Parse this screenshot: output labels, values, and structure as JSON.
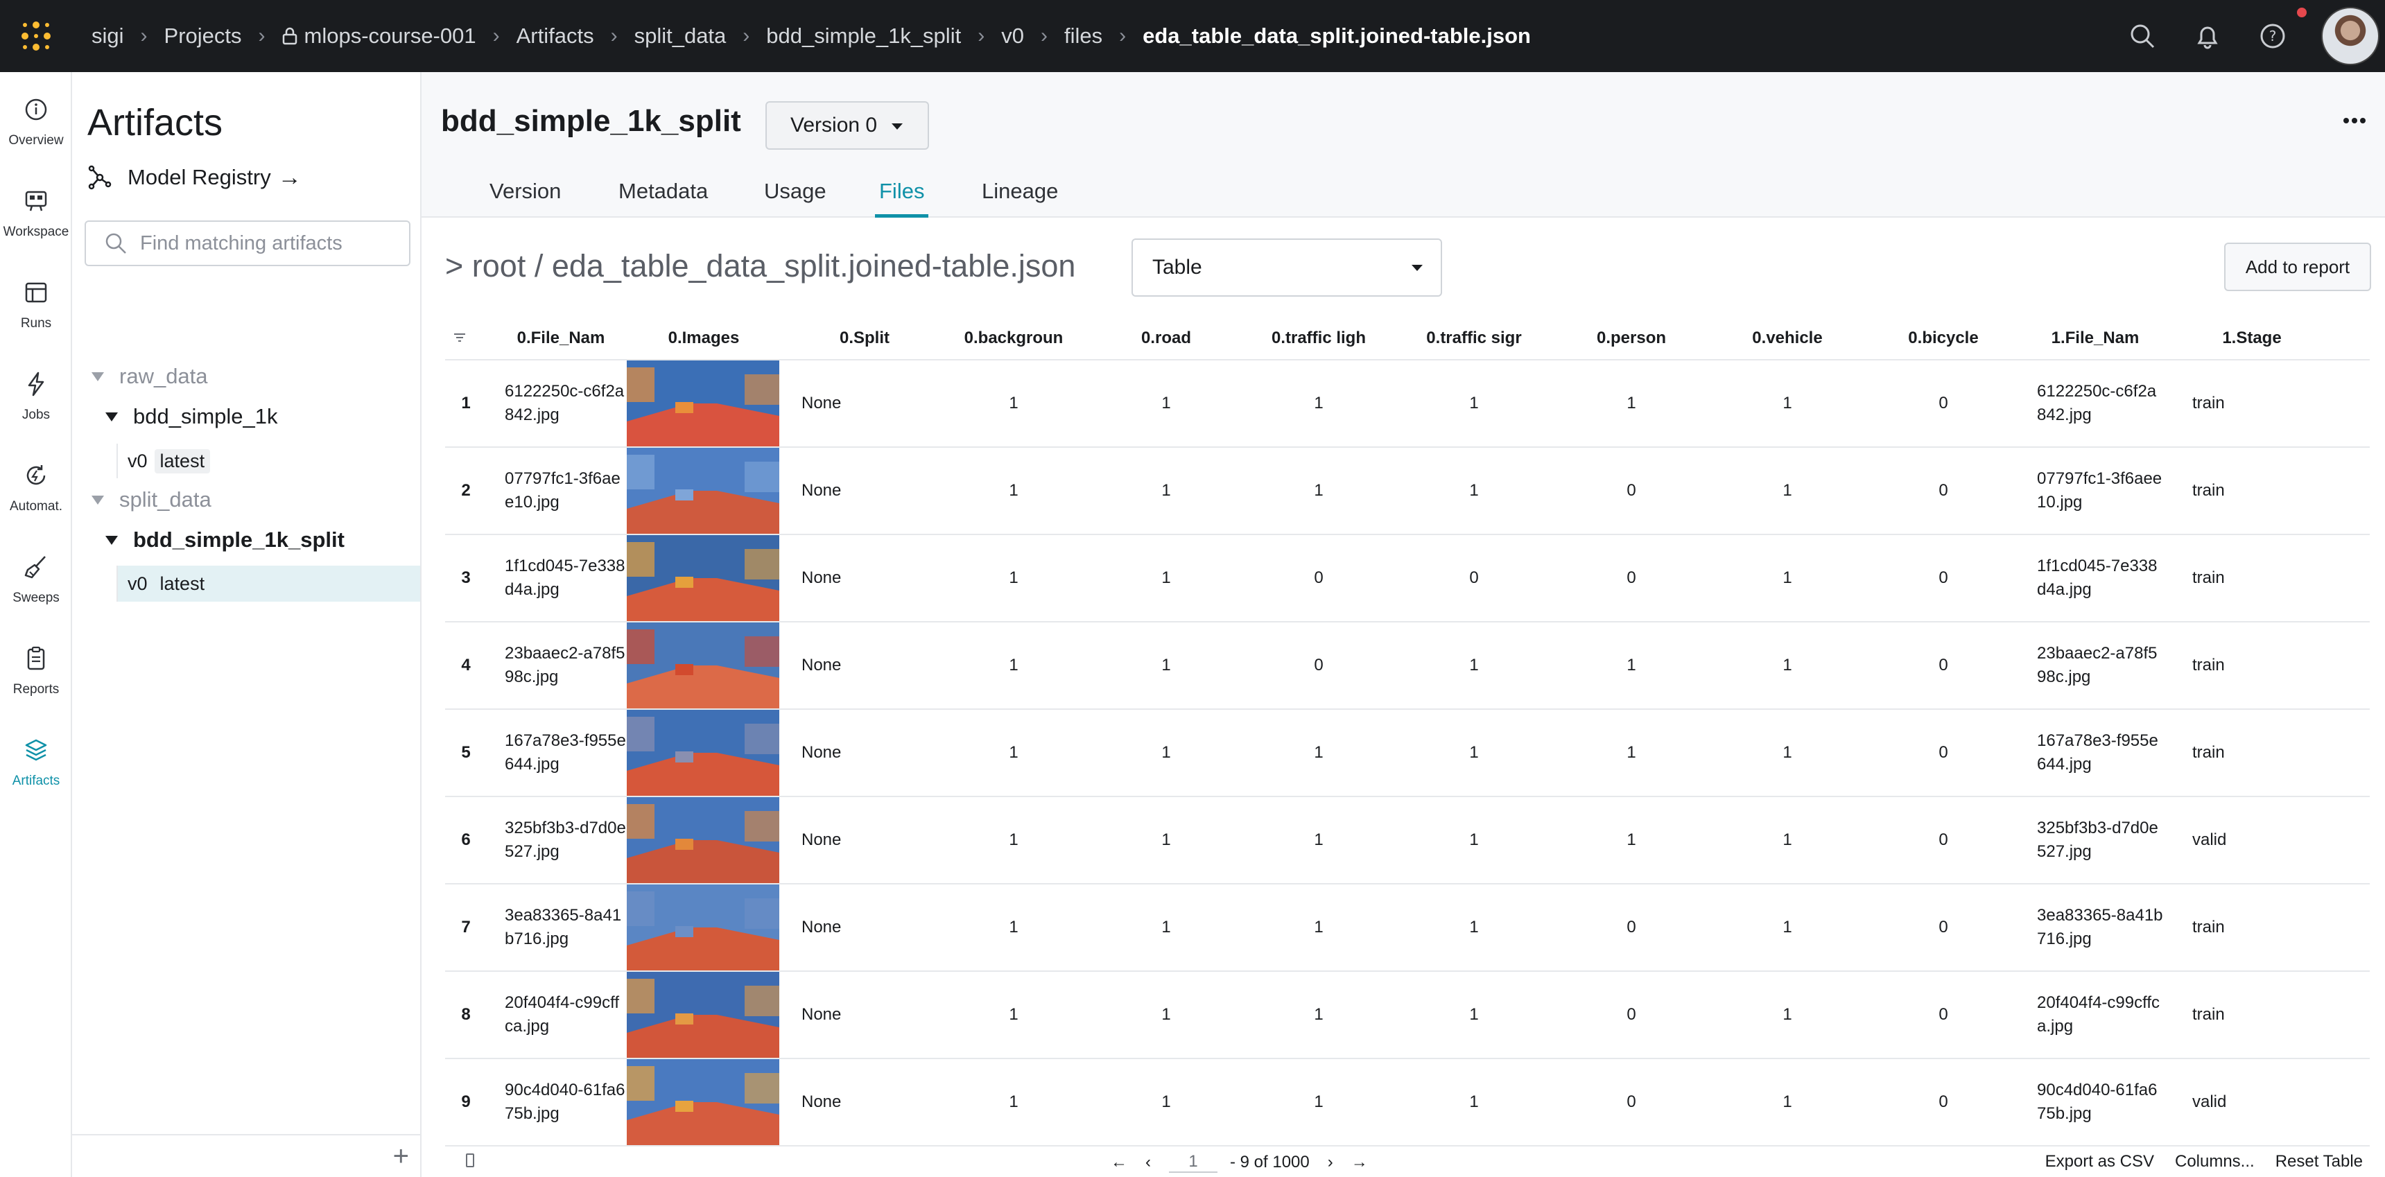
{
  "topbar": {
    "breadcrumbs": [
      "sigi",
      "Projects",
      "mlops-course-001",
      "Artifacts",
      "split_data",
      "bdd_simple_1k_split",
      "v0",
      "files",
      "eda_table_data_split.joined-table.json"
    ]
  },
  "leftnav": {
    "items": [
      {
        "label": "Overview",
        "icon": "info-icon"
      },
      {
        "label": "Workspace",
        "icon": "workspace-icon"
      },
      {
        "label": "Runs",
        "icon": "table-icon"
      },
      {
        "label": "Jobs",
        "icon": "lightning-icon"
      },
      {
        "label": "Automat.",
        "icon": "automation-icon"
      },
      {
        "label": "Sweeps",
        "icon": "broom-icon"
      },
      {
        "label": "Reports",
        "icon": "clipboard-icon"
      },
      {
        "label": "Artifacts",
        "icon": "layers-icon"
      }
    ],
    "active": "Artifacts"
  },
  "sidebar": {
    "title": "Artifacts",
    "model_registry": "Model Registry",
    "search_placeholder": "Find matching artifacts",
    "tree": {
      "type1": "raw_data",
      "type1_artifact": "bdd_simple_1k",
      "type1_version": "v0",
      "type1_tag": "latest",
      "type2": "split_data",
      "type2_artifact": "bdd_simple_1k_split",
      "type2_version": "v0",
      "type2_tag": "latest"
    }
  },
  "header": {
    "artifact_name": "bdd_simple_1k_split",
    "version_select": "Version 0",
    "tabs": [
      "Version",
      "Metadata",
      "Usage",
      "Files",
      "Lineage"
    ],
    "active_tab": "Files"
  },
  "files": {
    "path": "> root / eda_table_data_split.joined-table.json",
    "view_select": "Table",
    "add_to_report": "Add to report"
  },
  "table": {
    "columns": [
      "0.File_Nam",
      "0.Images",
      "0.Split",
      "0.backgroun",
      "0.road",
      "0.traffic ligh",
      "0.traffic sigr",
      "0.person",
      "0.vehicle",
      "0.bicycle",
      "1.File_Nam",
      "1.Stage"
    ],
    "rows": [
      {
        "idx": "1",
        "file": "6122250c-c6f2a842.jpg",
        "split": "None",
        "background": "1",
        "road": "1",
        "traffic_light": "1",
        "traffic_sign": "1",
        "person": "1",
        "vehicle": "1",
        "bicycle": "0",
        "file1": "6122250c-c6f2a842.jpg",
        "stage": "train"
      },
      {
        "idx": "2",
        "file": "07797fc1-3f6aee10.jpg",
        "split": "None",
        "background": "1",
        "road": "1",
        "traffic_light": "1",
        "traffic_sign": "1",
        "person": "0",
        "vehicle": "1",
        "bicycle": "0",
        "file1": "07797fc1-3f6aee10.jpg",
        "stage": "train"
      },
      {
        "idx": "3",
        "file": "1f1cd045-7e338d4a.jpg",
        "split": "None",
        "background": "1",
        "road": "1",
        "traffic_light": "0",
        "traffic_sign": "0",
        "person": "0",
        "vehicle": "1",
        "bicycle": "0",
        "file1": "1f1cd045-7e338d4a.jpg",
        "stage": "train"
      },
      {
        "idx": "4",
        "file": "23baaec2-a78f598c.jpg",
        "split": "None",
        "background": "1",
        "road": "1",
        "traffic_light": "0",
        "traffic_sign": "1",
        "person": "1",
        "vehicle": "1",
        "bicycle": "0",
        "file1": "23baaec2-a78f598c.jpg",
        "stage": "train"
      },
      {
        "idx": "5",
        "file": "167a78e3-f955e644.jpg",
        "split": "None",
        "background": "1",
        "road": "1",
        "traffic_light": "1",
        "traffic_sign": "1",
        "person": "1",
        "vehicle": "1",
        "bicycle": "0",
        "file1": "167a78e3-f955e644.jpg",
        "stage": "train"
      },
      {
        "idx": "6",
        "file": "325bf3b3-d7d0e527.jpg",
        "split": "None",
        "background": "1",
        "road": "1",
        "traffic_light": "1",
        "traffic_sign": "1",
        "person": "1",
        "vehicle": "1",
        "bicycle": "0",
        "file1": "325bf3b3-d7d0e527.jpg",
        "stage": "valid"
      },
      {
        "idx": "7",
        "file": "3ea83365-8a41b716.jpg",
        "split": "None",
        "background": "1",
        "road": "1",
        "traffic_light": "1",
        "traffic_sign": "1",
        "person": "0",
        "vehicle": "1",
        "bicycle": "0",
        "file1": "3ea83365-8a41b716.jpg",
        "stage": "train"
      },
      {
        "idx": "8",
        "file": "20f404f4-c99cffca.jpg",
        "split": "None",
        "background": "1",
        "road": "1",
        "traffic_light": "1",
        "traffic_sign": "1",
        "person": "0",
        "vehicle": "1",
        "bicycle": "0",
        "file1": "20f404f4-c99cffca.jpg",
        "stage": "train"
      },
      {
        "idx": "9",
        "file": "90c4d040-61fa675b.jpg",
        "split": "None",
        "background": "1",
        "road": "1",
        "traffic_light": "1",
        "traffic_sign": "1",
        "person": "0",
        "vehicle": "1",
        "bicycle": "0",
        "file1": "90c4d040-61fa675b.jpg",
        "stage": "valid"
      }
    ]
  },
  "footer": {
    "page": "1",
    "range": "- 9 of 1000",
    "export": "Export as CSV",
    "columns": "Columns...",
    "reset": "Reset Table"
  },
  "colors": {
    "accent": "#0f91a8",
    "topbar": "#1a1c1f",
    "logo": "#fcbc32",
    "notification": "#e5484d"
  }
}
